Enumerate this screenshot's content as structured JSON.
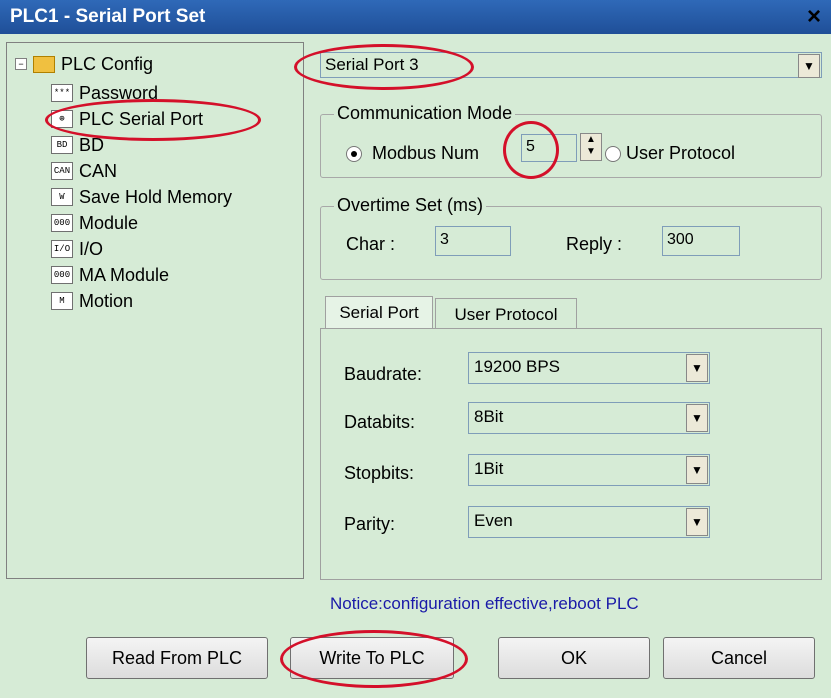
{
  "window": {
    "title": "PLC1 - Serial Port  Set",
    "close": "×"
  },
  "tree": {
    "root": "PLC Config",
    "items": [
      "Password",
      "PLC Serial Port",
      "BD",
      "CAN",
      "Save Hold Memory",
      "Module",
      "I/O",
      "MA Module",
      "Motion"
    ],
    "icons": [
      "password-icon",
      "serial-port-icon",
      "bd-icon",
      "can-icon",
      "memory-icon",
      "module-icon",
      "io-icon",
      "ma-module-icon",
      "motion-icon"
    ],
    "icon_text": [
      "***",
      "⊕",
      "BD",
      "CAN",
      "Ⱳ",
      "000",
      "I/O",
      "000",
      "M"
    ]
  },
  "port_select": {
    "value": "Serial Port 3"
  },
  "comm_mode": {
    "title": "Communication Mode",
    "modbus_label": "Modbus Num",
    "modbus_value": "5",
    "user_protocol_label": "User Protocol"
  },
  "overtime": {
    "title": "Overtime Set (ms)",
    "char_label": "Char :",
    "char_value": "3",
    "reply_label": "Reply :",
    "reply_value": "300"
  },
  "tabs": [
    "Serial Port",
    "User Protocol"
  ],
  "serial": {
    "baud_label": "Baudrate:",
    "baud_value": "19200 BPS",
    "data_label": "Databits:",
    "data_value": "8Bit",
    "stop_label": "Stopbits:",
    "stop_value": "1Bit",
    "parity_label": "Parity:",
    "parity_value": "Even"
  },
  "notice": "Notice:configuration effective,reboot PLC",
  "buttons": {
    "read": "Read From PLC",
    "write": "Write To PLC",
    "ok": "OK",
    "cancel": "Cancel"
  },
  "colors": {
    "highlight": "#d4102a",
    "notice": "#1a1aa8",
    "titlebar": "#2f69b8",
    "panel": "#d6ebd6"
  }
}
